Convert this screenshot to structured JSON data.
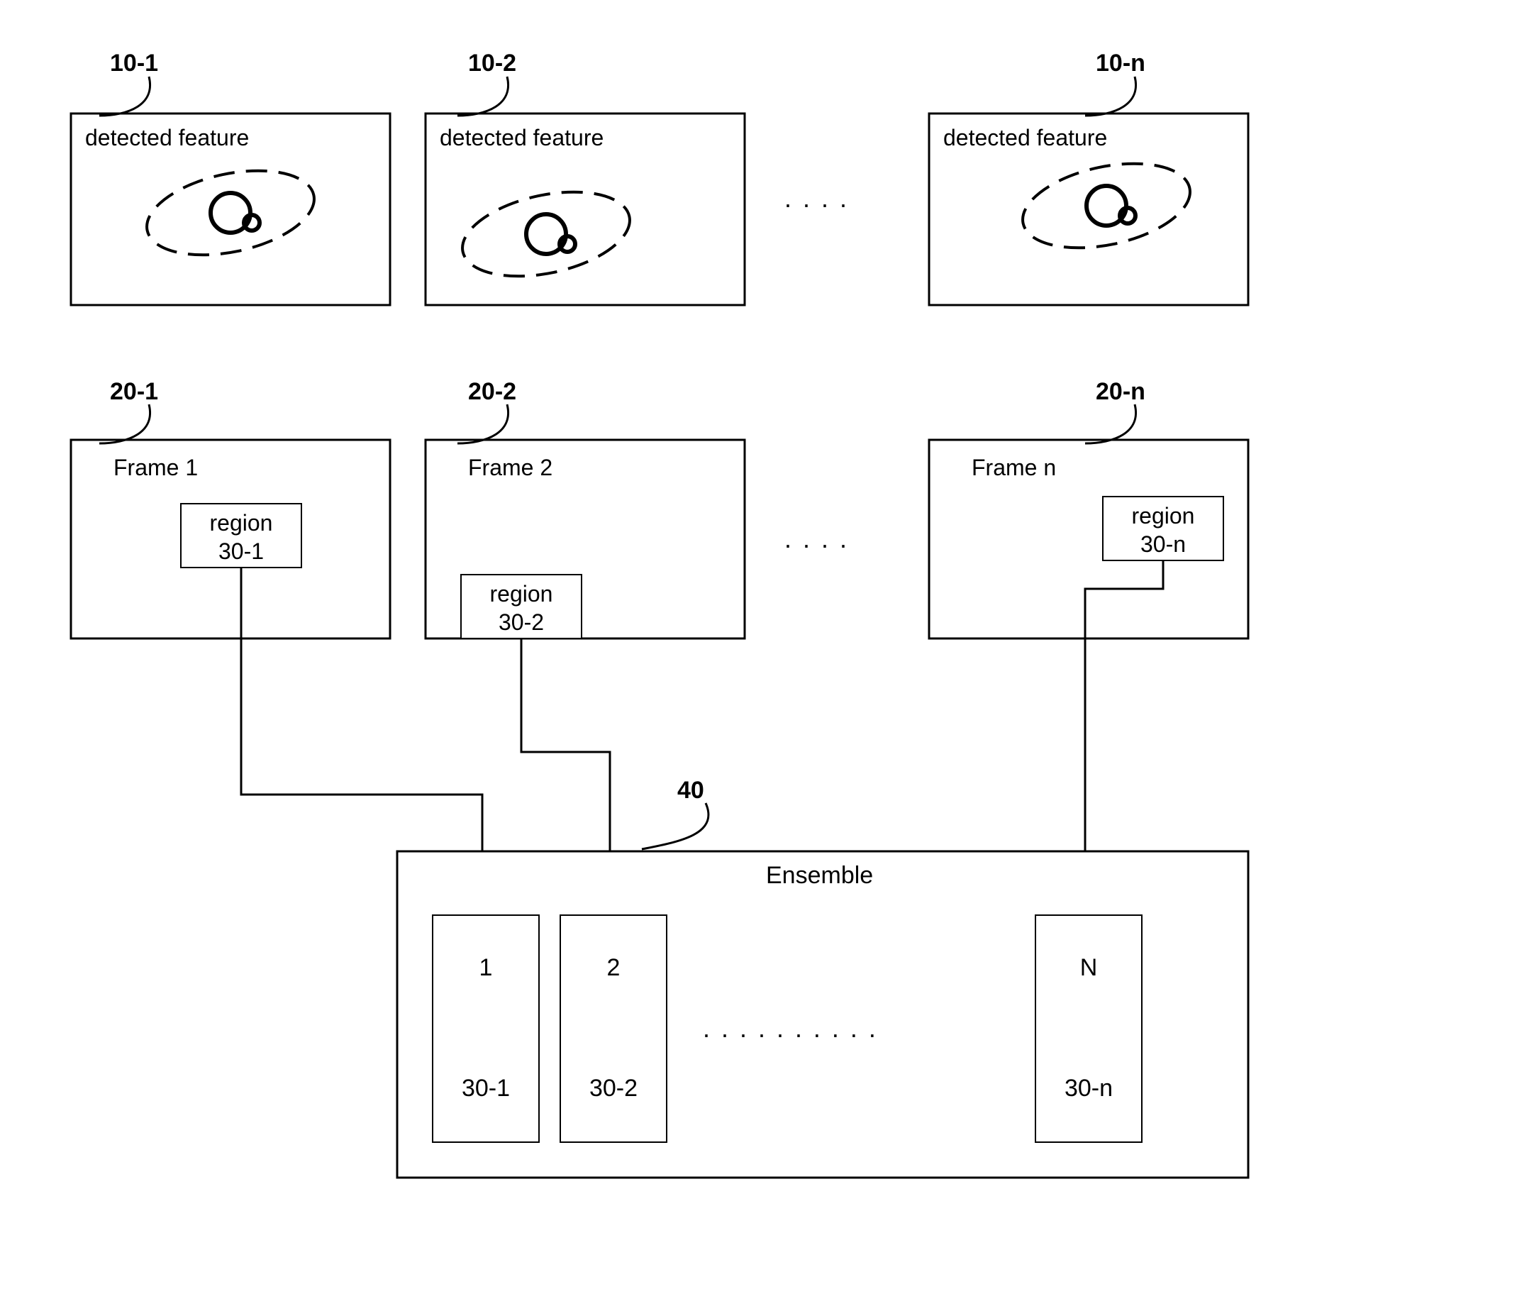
{
  "detected": {
    "label1": "detected feature",
    "label2": "detected feature",
    "label3": "detected feature",
    "ref1": "10-1",
    "ref2": "10-2",
    "refn": "10-n"
  },
  "frames": {
    "label1": "Frame 1",
    "label2": "Frame 2",
    "labeln": "Frame n",
    "ref1": "20-1",
    "ref2": "20-2",
    "refn": "20-n",
    "region1a": "region",
    "region1b": "30-1",
    "region2a": "region",
    "region2b": "30-2",
    "regionna": "region",
    "regionnb": "30-n"
  },
  "ensemble": {
    "title": "Ensemble",
    "ref": "40",
    "item1_top": "1",
    "item1_bot": "30-1",
    "item2_top": "2",
    "item2_bot": "30-2",
    "itemn_top": "N",
    "itemn_bot": "30-n"
  }
}
